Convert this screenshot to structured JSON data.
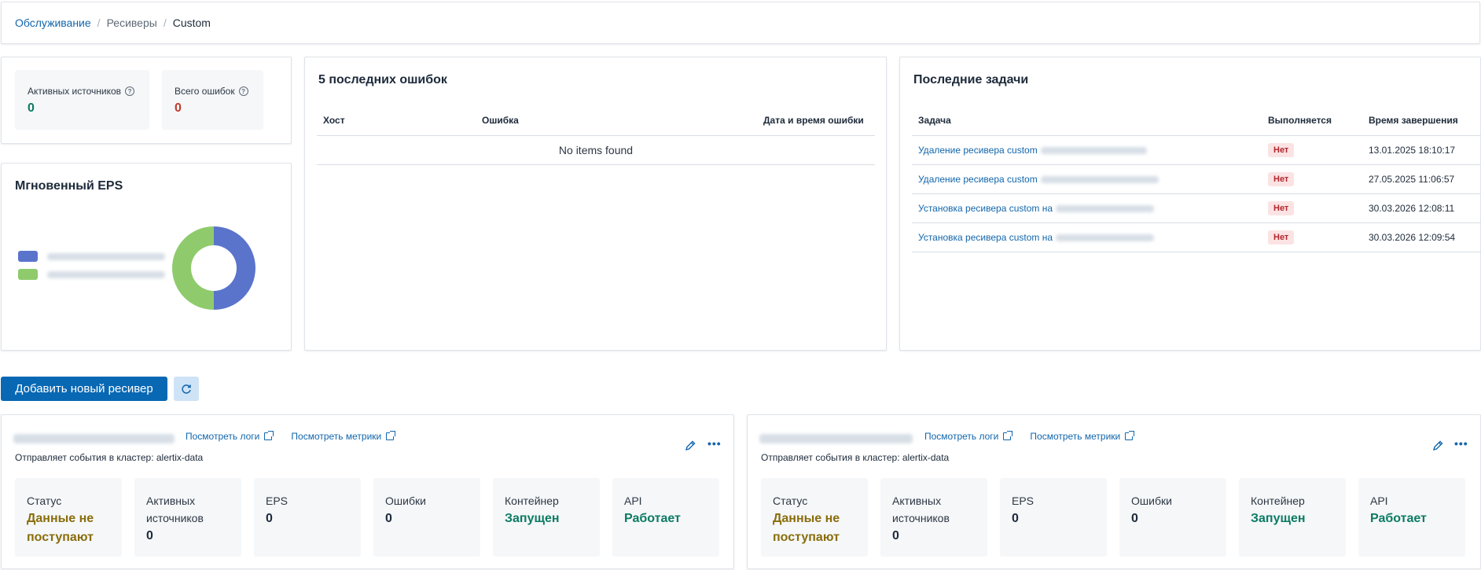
{
  "breadcrumb": {
    "item1": "Обслуживание",
    "item2": "Ресиверы",
    "current": "Custom"
  },
  "stats": {
    "active_sources": {
      "label": "Активных источников",
      "value": "0",
      "color": "#0c7b63"
    },
    "total_errors": {
      "label": "Всего ошибок",
      "value": "0",
      "color": "#c0392b"
    }
  },
  "eps": {
    "title": "Мгновенный EPS",
    "colors": [
      "#5a74cc",
      "#8fcb6c"
    ]
  },
  "errors_panel": {
    "title": "5 последних ошибок",
    "columns": [
      "Хост",
      "Ошибка",
      "Дата и время ошибки"
    ],
    "empty_text": "No items found"
  },
  "tasks_panel": {
    "title": "Последние задачи",
    "columns": [
      "Задача",
      "Выполняется",
      "Время завершения"
    ],
    "rows": [
      {
        "task": "Удаление ресивера custom",
        "running": "Нет",
        "finished": "13.01.2025 18:10:17"
      },
      {
        "task": "Удаление ресивера custom",
        "running": "Нет",
        "finished": "27.05.2025 11:06:57"
      },
      {
        "task": "Установка ресивера custom на",
        "running": "Нет",
        "finished": "30.03.2026 12:08:11"
      },
      {
        "task": "Установка ресивера custom на",
        "running": "Нет",
        "finished": "30.03.2026 12:09:54"
      }
    ]
  },
  "actions": {
    "add_receiver": "Добавить новый ресивер"
  },
  "receivers": [
    {
      "logs_link": "Посмотреть логи",
      "metrics_link": "Посмотреть метрики",
      "cluster_text": "Отправляет события в кластер: alertix-data",
      "metrics": [
        {
          "label": "Статус",
          "value": "Данные не поступают",
          "kind": "warn"
        },
        {
          "label": "Активных источников",
          "value": "0",
          "kind": "plain"
        },
        {
          "label": "EPS",
          "value": "0",
          "kind": "plain"
        },
        {
          "label": "Ошибки",
          "value": "0",
          "kind": "plain"
        },
        {
          "label": "Контейнер",
          "value": "Запущен",
          "kind": "ok"
        },
        {
          "label": "API",
          "value": "Работает",
          "kind": "ok"
        }
      ]
    },
    {
      "logs_link": "Посмотреть логи",
      "metrics_link": "Посмотреть метрики",
      "cluster_text": "Отправляет события в кластер: alertix-data",
      "metrics": [
        {
          "label": "Статус",
          "value": "Данные не поступают",
          "kind": "warn"
        },
        {
          "label": "Активных источников",
          "value": "0",
          "kind": "plain"
        },
        {
          "label": "EPS",
          "value": "0",
          "kind": "plain"
        },
        {
          "label": "Ошибки",
          "value": "0",
          "kind": "plain"
        },
        {
          "label": "Контейнер",
          "value": "Запущен",
          "kind": "ok"
        },
        {
          "label": "API",
          "value": "Работает",
          "kind": "ok"
        }
      ]
    }
  ]
}
